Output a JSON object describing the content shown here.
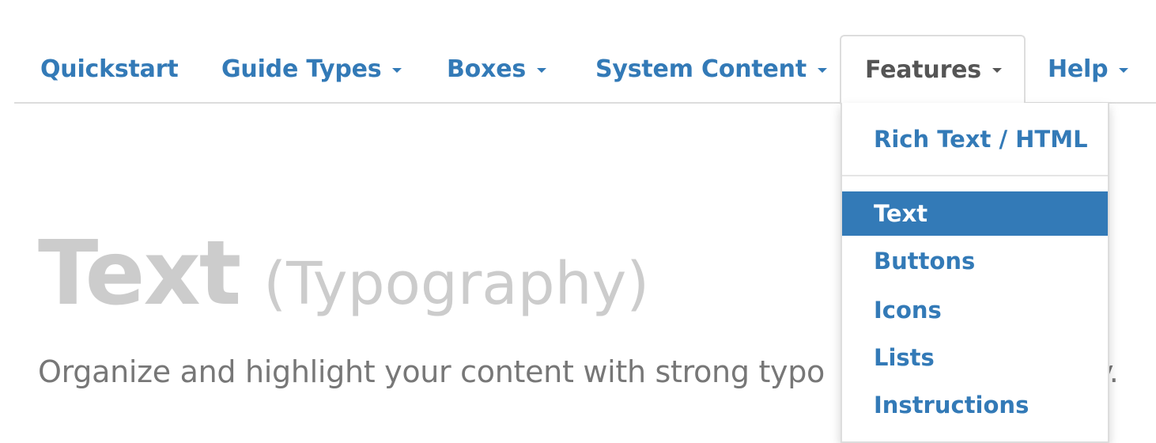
{
  "nav": {
    "items": [
      {
        "label": "Quickstart"
      },
      {
        "label": "Guide Types"
      },
      {
        "label": "Boxes"
      },
      {
        "label": "System Content"
      },
      {
        "label": "Features"
      },
      {
        "label": "Help"
      }
    ],
    "active": "Features"
  },
  "features_menu": {
    "items": [
      {
        "label": "Rich Text / HTML"
      },
      {
        "label": "Text"
      },
      {
        "label": "Buttons"
      },
      {
        "label": "Icons"
      },
      {
        "label": "Lists"
      },
      {
        "label": "Instructions"
      }
    ],
    "selected": "Text"
  },
  "hero": {
    "title": "Text",
    "title_suffix": "(Typography)",
    "subtitle_start": "Organize and highlight your content with strong typo",
    "subtitle_end": "y."
  },
  "colors": {
    "link": "#337ab7",
    "active_tab_text": "#555555",
    "selected_bg": "#337ab7",
    "hero_title": "#cccccc",
    "hero_subtitle": "#777777"
  },
  "icons": {
    "dropdown_caret": "caret-down-icon"
  }
}
